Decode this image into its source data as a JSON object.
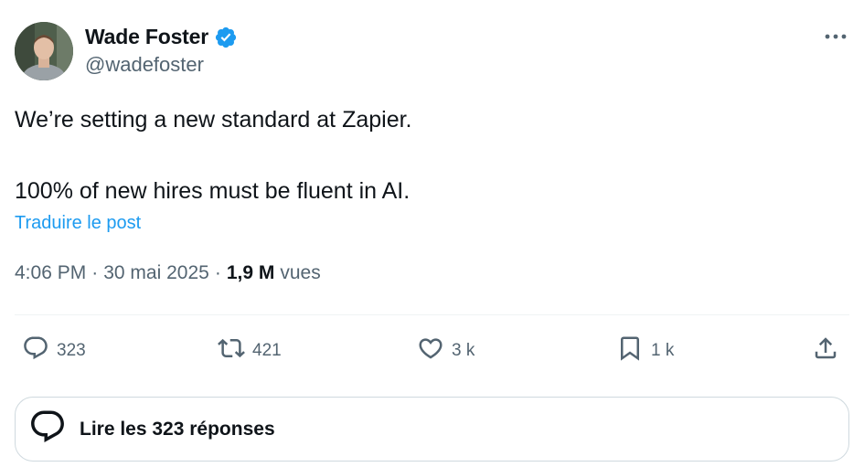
{
  "author": {
    "name": "Wade Foster",
    "handle": "@wadefoster",
    "verified": true
  },
  "tweet": {
    "lines": [
      "We’re setting a new standard at Zapier.",
      "100% of new hires must be fluent in AI."
    ],
    "translate_label": "Traduire le post",
    "time": "4:06 PM",
    "separator": "·",
    "date": "30 mai 2025",
    "views_count": "1,9 M",
    "views_label": "vues"
  },
  "actions": {
    "reply_count": "323",
    "retweet_count": "421",
    "like_count": "3 k",
    "bookmark_count": "1 k"
  },
  "replies_button": {
    "label": "Lire les 323 réponses"
  },
  "colors": {
    "text": "#0f1419",
    "secondary": "#536471",
    "link": "#1d9bf0",
    "verified": "#1d9bf0",
    "border": "#cfd9de"
  },
  "icons": [
    "verified-badge-icon",
    "more-icon",
    "reply-icon",
    "retweet-icon",
    "like-icon",
    "bookmark-icon",
    "share-icon",
    "replies-bubble-icon"
  ]
}
